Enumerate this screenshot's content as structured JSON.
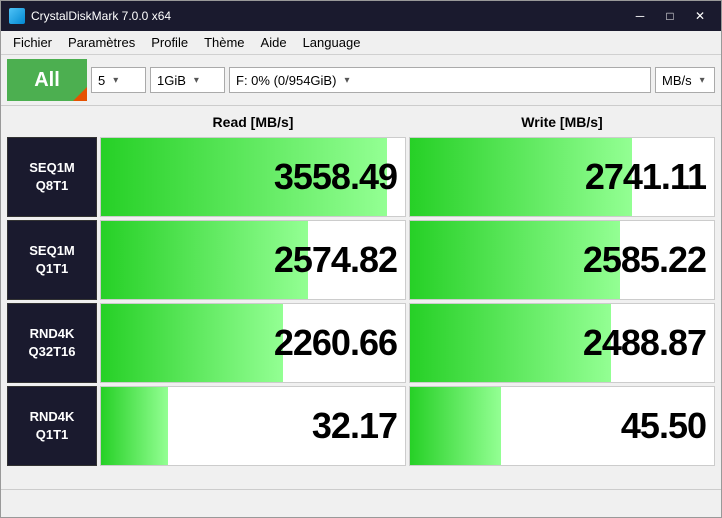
{
  "window": {
    "title": "CrystalDiskMark 7.0.0 x64",
    "icon": "disk-icon"
  },
  "titleButtons": {
    "minimize": "─",
    "maximize": "□",
    "close": "✕"
  },
  "menu": {
    "items": [
      {
        "label": "Fichier",
        "id": "fichier"
      },
      {
        "label": "Paramètres",
        "id": "parametres"
      },
      {
        "label": "Profile",
        "id": "profile"
      },
      {
        "label": "Thème",
        "id": "theme"
      },
      {
        "label": "Aide",
        "id": "aide"
      },
      {
        "label": "Language",
        "id": "language"
      }
    ]
  },
  "toolbar": {
    "all_button": "All",
    "count_value": "5",
    "count_arrow": "▾",
    "size_value": "1GiB",
    "size_arrow": "▾",
    "drive_value": "F: 0% (0/954GiB)",
    "drive_arrow": "▾",
    "unit_value": "MB/s",
    "unit_arrow": "▾"
  },
  "table": {
    "header": {
      "read": "Read [MB/s]",
      "write": "Write [MB/s]"
    },
    "rows": [
      {
        "label_line1": "SEQ1M",
        "label_line2": "Q8T1",
        "read_value": "3558.49",
        "write_value": "2741.11",
        "read_bar_pct": 94,
        "write_bar_pct": 73
      },
      {
        "label_line1": "SEQ1M",
        "label_line2": "Q1T1",
        "read_value": "2574.82",
        "write_value": "2585.22",
        "read_bar_pct": 68,
        "write_bar_pct": 69
      },
      {
        "label_line1": "RND4K",
        "label_line2": "Q32T16",
        "read_value": "2260.66",
        "write_value": "2488.87",
        "read_bar_pct": 60,
        "write_bar_pct": 66
      },
      {
        "label_line1": "RND4K",
        "label_line2": "Q1T1",
        "read_value": "32.17",
        "write_value": "45.50",
        "read_bar_pct": 22,
        "write_bar_pct": 30
      }
    ]
  }
}
